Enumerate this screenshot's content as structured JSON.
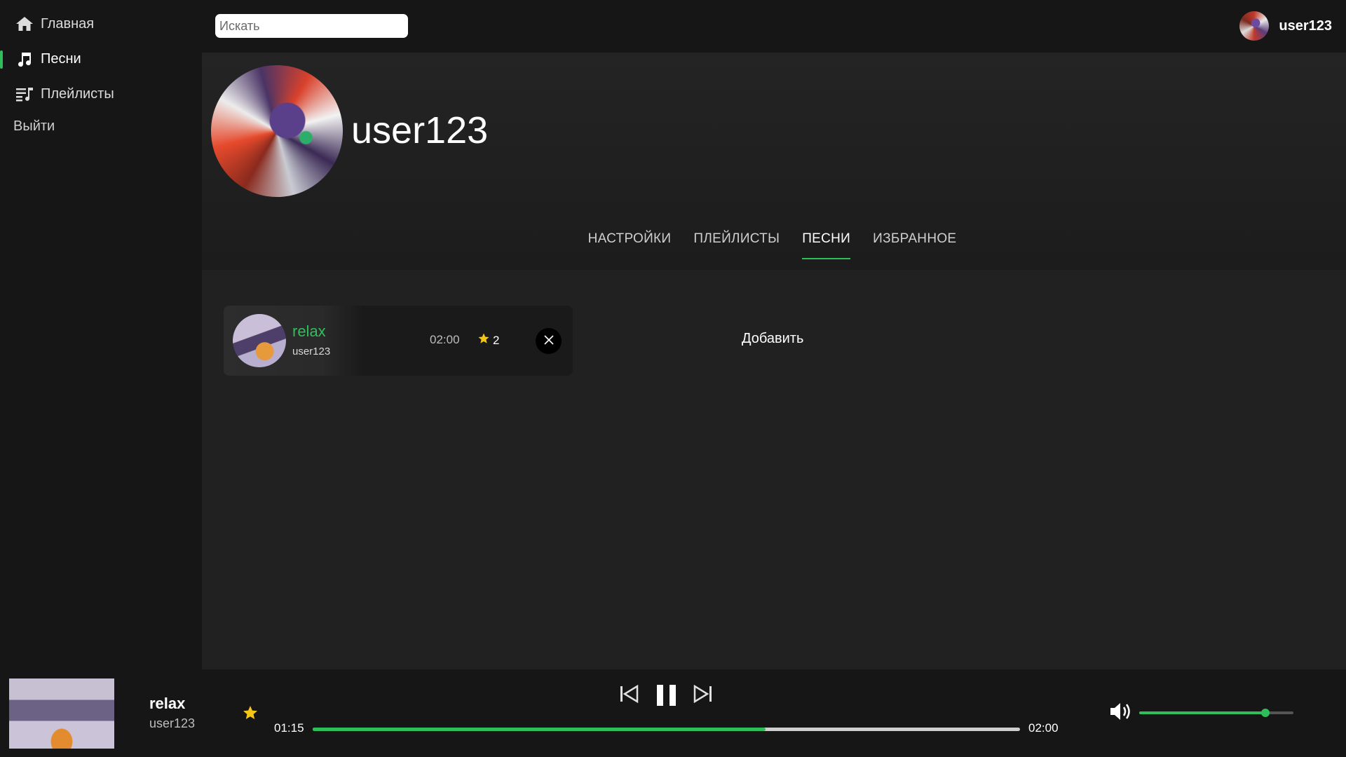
{
  "sidebar": {
    "items": [
      {
        "label": "Главная",
        "icon": "home-icon",
        "active": false
      },
      {
        "label": "Песни",
        "icon": "music-note-icon",
        "active": true
      },
      {
        "label": "Плейлисты",
        "icon": "playlist-icon",
        "active": false
      }
    ],
    "logout_label": "Выйти"
  },
  "search": {
    "placeholder": "Искать",
    "value": ""
  },
  "top_user": {
    "name": "user123"
  },
  "profile": {
    "name": "user123",
    "tabs": [
      {
        "label": "НАСТРОЙКИ",
        "active": false
      },
      {
        "label": "ПЛЕЙЛИСТЫ",
        "active": false
      },
      {
        "label": "ПЕСНИ",
        "active": true
      },
      {
        "label": "ИЗБРАННОЕ",
        "active": false
      }
    ]
  },
  "songs": [
    {
      "title": "relax",
      "artist": "user123",
      "duration": "02:00",
      "favorites": "2"
    }
  ],
  "add_label": "Добавить",
  "player": {
    "title": "relax",
    "artist": "user123",
    "current_time": "01:15",
    "total_time": "02:00",
    "progress_fraction": 0.64,
    "volume_fraction": 0.82
  },
  "colors": {
    "accent": "#2fbf5a",
    "star": "#f5c518",
    "background": "#212121",
    "panel": "#161616"
  }
}
